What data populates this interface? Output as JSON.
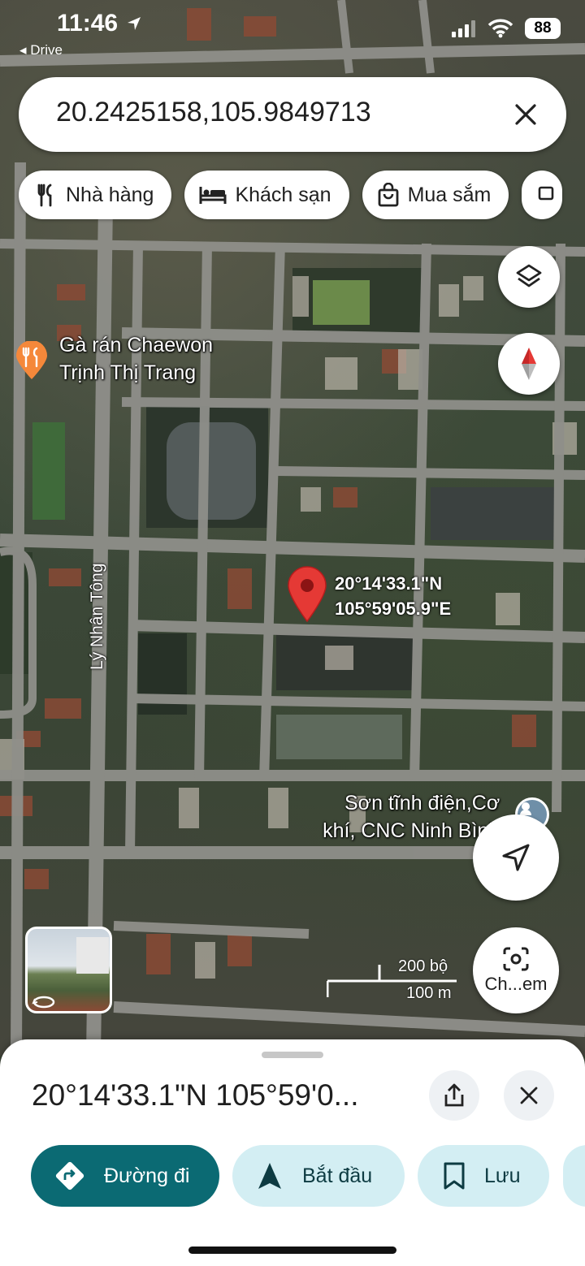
{
  "status_bar": {
    "time": "11:46",
    "back_app": "Drive",
    "battery": "88"
  },
  "search": {
    "query": "20.2425158,105.9849713"
  },
  "chips": [
    {
      "label": "Nhà hàng",
      "icon": "restaurant-icon"
    },
    {
      "label": "Khách sạn",
      "icon": "hotel-icon"
    },
    {
      "label": "Mua sắm",
      "icon": "shopping-bag-icon"
    }
  ],
  "map": {
    "places": [
      {
        "line1": "Gà rán Chaewon",
        "line2": "Trịnh Thị Trang"
      },
      {
        "line1": "Sơn tĩnh điện,Cơ",
        "line2": "khí, CNC Ninh Bình"
      }
    ],
    "street": "Lý Nhân Tông",
    "pin": {
      "lat": "20°14'33.1\"N",
      "lng": "105°59'05.9\"E"
    },
    "scale": {
      "imperial": "200 bộ",
      "metric": "100 m"
    },
    "camera_button_label": "Ch...em"
  },
  "sheet": {
    "title": "20°14'33.1\"N 105°59'0...",
    "actions": [
      {
        "label": "Đường đi"
      },
      {
        "label": "Bắt đầu"
      },
      {
        "label": "Lưu"
      }
    ]
  },
  "colors": {
    "primary": "#0b6a73",
    "secondary": "#d3eef3",
    "pin": "#e53935",
    "place_marker": "#f5883a"
  }
}
